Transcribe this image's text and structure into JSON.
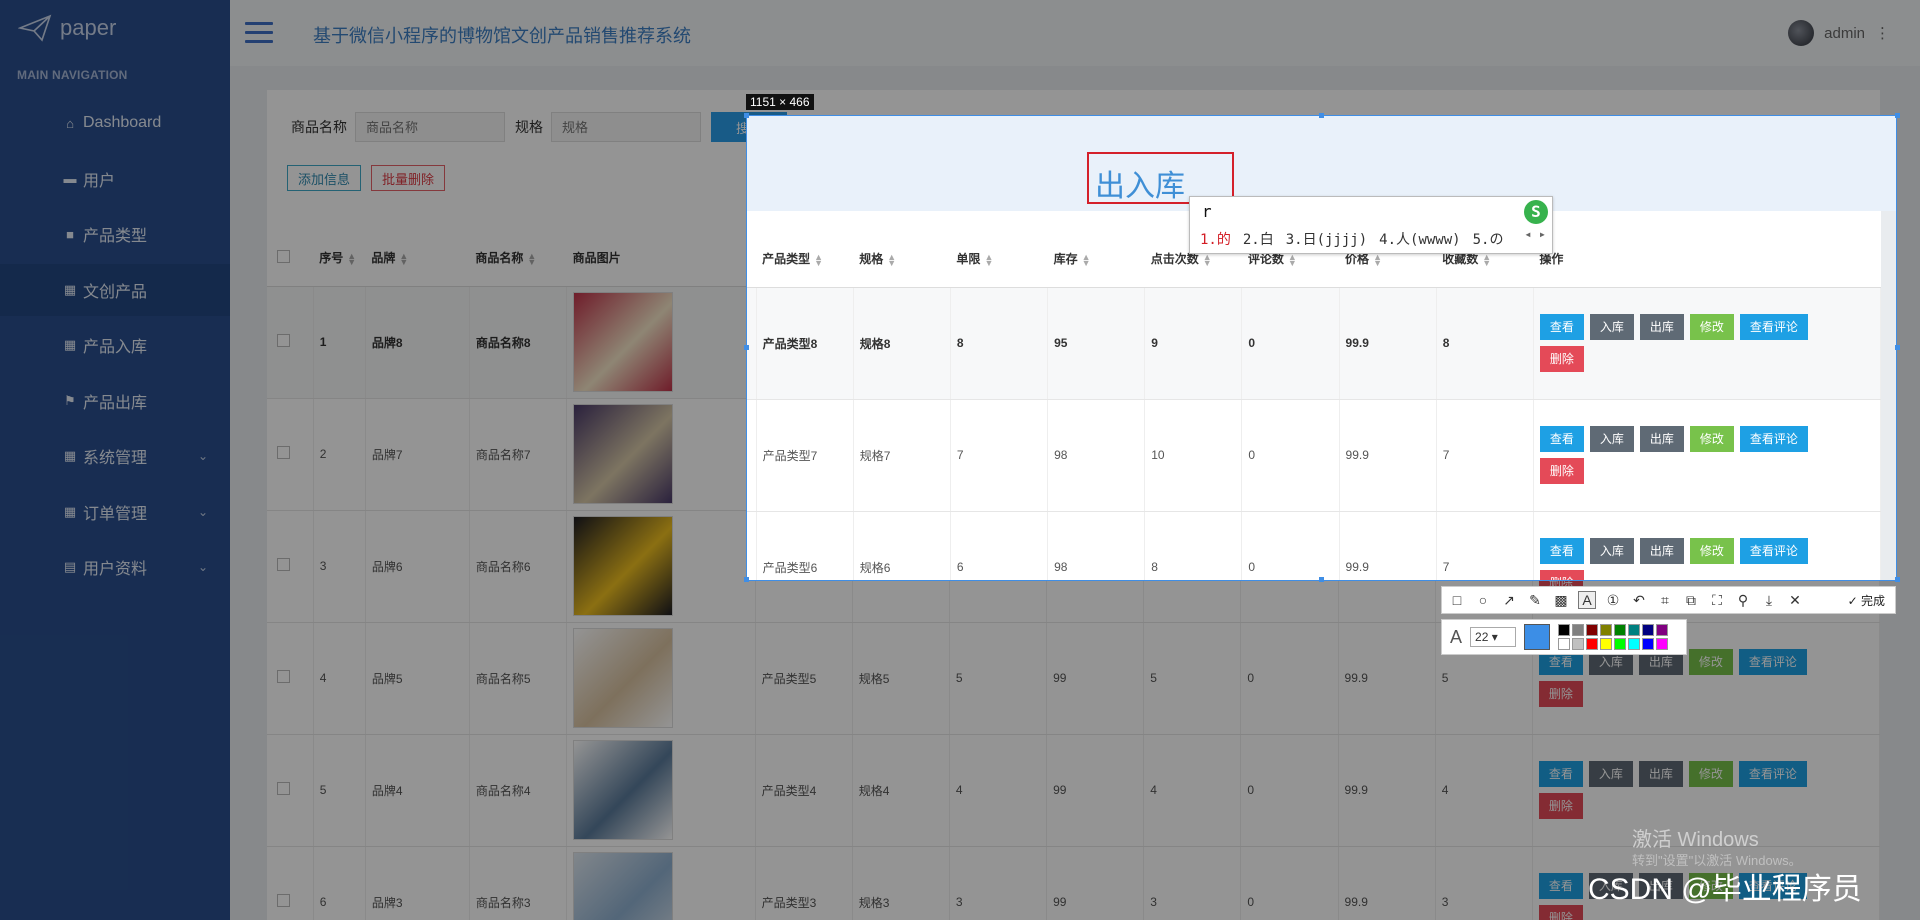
{
  "app": {
    "logo_text": "paper",
    "title": "基于微信小程序的博物馆文创产品销售推荐系统",
    "user": "admin"
  },
  "sidebar": {
    "header": "MAIN NAVIGATION",
    "items": [
      {
        "label": "Dashboard",
        "icon": "home-icon"
      },
      {
        "label": "用户",
        "icon": "monitor-icon"
      },
      {
        "label": "产品类型",
        "icon": "square-icon"
      },
      {
        "label": "文创产品",
        "icon": "grid-icon",
        "active": true
      },
      {
        "label": "产品入库",
        "icon": "grid-icon"
      },
      {
        "label": "产品出库",
        "icon": "flag-icon"
      },
      {
        "label": "系统管理",
        "icon": "grid-icon",
        "expandable": true
      },
      {
        "label": "订单管理",
        "icon": "grid-icon",
        "expandable": true
      },
      {
        "label": "用户资料",
        "icon": "id-card-icon",
        "expandable": true
      }
    ]
  },
  "search": {
    "name_label": "商品名称",
    "name_placeholder": "商品名称",
    "spec_label": "规格",
    "spec_placeholder": "规格",
    "button": "搜索"
  },
  "ops": {
    "add": "添加信息",
    "bulk_delete": "批量删除"
  },
  "table": {
    "headers": [
      "序号",
      "品牌",
      "商品名称",
      "商品图片",
      "产品类型",
      "规格",
      "单限",
      "库存",
      "点击次数",
      "评论数",
      "价格",
      "收藏数",
      "操作"
    ],
    "rows": [
      {
        "no": "1",
        "brand": "品牌8",
        "name": "商品名称8",
        "type": "产品类型8",
        "spec": "规格8",
        "limit": "8",
        "stock": "95",
        "clicks": "9",
        "comments": "0",
        "price": "99.9",
        "favs": "8"
      },
      {
        "no": "2",
        "brand": "品牌7",
        "name": "商品名称7",
        "type": "产品类型7",
        "spec": "规格7",
        "limit": "7",
        "stock": "98",
        "clicks": "10",
        "comments": "0",
        "price": "99.9",
        "favs": "7"
      },
      {
        "no": "3",
        "brand": "品牌6",
        "name": "商品名称6",
        "type": "产品类型6",
        "spec": "规格6",
        "limit": "6",
        "stock": "98",
        "clicks": "8",
        "comments": "0",
        "price": "99.9",
        "favs": "7"
      },
      {
        "no": "4",
        "brand": "品牌5",
        "name": "商品名称5",
        "type": "产品类型5",
        "spec": "规格5",
        "limit": "5",
        "stock": "99",
        "clicks": "5",
        "comments": "0",
        "price": "99.9",
        "favs": "5"
      },
      {
        "no": "5",
        "brand": "品牌4",
        "name": "商品名称4",
        "type": "产品类型4",
        "spec": "规格4",
        "limit": "4",
        "stock": "99",
        "clicks": "4",
        "comments": "0",
        "price": "99.9",
        "favs": "4"
      },
      {
        "no": "6",
        "brand": "品牌3",
        "name": "商品名称3",
        "type": "产品类型3",
        "spec": "规格3",
        "limit": "3",
        "stock": "99",
        "clicks": "3",
        "comments": "0",
        "price": "99.9",
        "favs": "3"
      }
    ],
    "actions": {
      "view": "查看",
      "in": "入库",
      "out": "出库",
      "edit": "修改",
      "comments": "查看评论",
      "delete": "删除"
    }
  },
  "overlay": {
    "snip_size": "1151 × 466",
    "modal_title": "出入库",
    "ime_input": "r",
    "ime_candidates": [
      "1.的",
      "2.白",
      "3.日(jjjj)",
      "4.人(wwww)",
      "5.の"
    ],
    "done": "完成",
    "font_size": "22"
  },
  "watermarks": {
    "activate": "激活 Windows",
    "activate_sub": "转到\"设置\"以激活 Windows。",
    "csdn": "CSDN @毕业程序员"
  },
  "colors": {
    "sidebar": "#2a4f8e",
    "accent": "#1ea0e4",
    "danger": "#e44a58",
    "success": "#78c24b",
    "palette": [
      "#000000",
      "#808080",
      "#800000",
      "#808000",
      "#008000",
      "#008080",
      "#000080",
      "#800080",
      "#ffffff",
      "#c0c0c0",
      "#ff0000",
      "#ffff00",
      "#00ff00",
      "#00ffff",
      "#0000ff",
      "#ff00ff"
    ]
  }
}
